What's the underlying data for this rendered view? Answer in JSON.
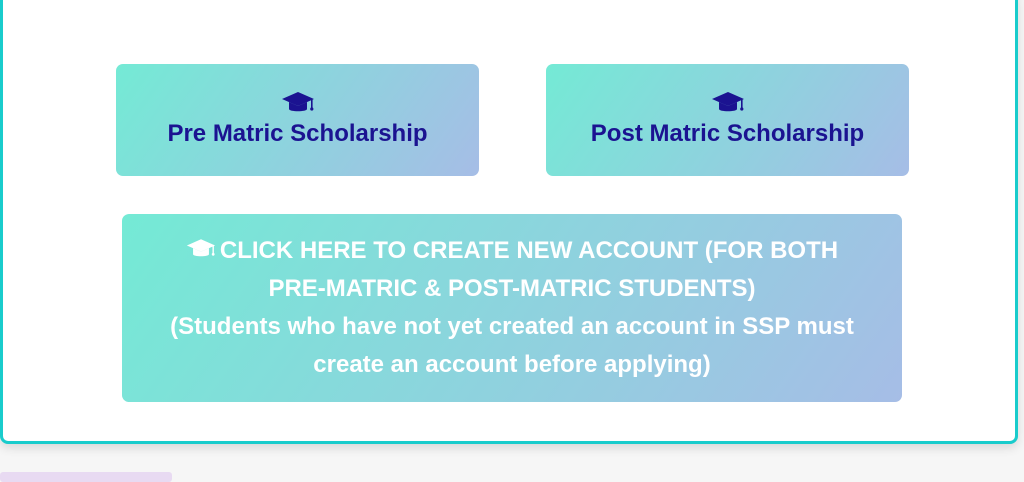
{
  "cards": {
    "pre_matric": {
      "label": "Pre Matric Scholarship",
      "icon": "graduation-cap-icon"
    },
    "post_matric": {
      "label": "Post Matric Scholarship",
      "icon": "graduation-cap-icon"
    }
  },
  "create_account": {
    "icon": "graduation-cap-icon",
    "line1": "CLICK HERE TO CREATE NEW ACCOUNT (FOR BOTH",
    "line2": "PRE-MATRIC & POST-MATRIC STUDENTS)",
    "line3": "(Students who have not yet created an account in SSP must",
    "line4": "create an account before applying)"
  },
  "colors": {
    "panel_border": "#19cccc",
    "card_gradient_start": "#74ead5",
    "card_gradient_end": "#a6bde6",
    "card_label": "#1b1391",
    "create_text": "#ffffff"
  }
}
